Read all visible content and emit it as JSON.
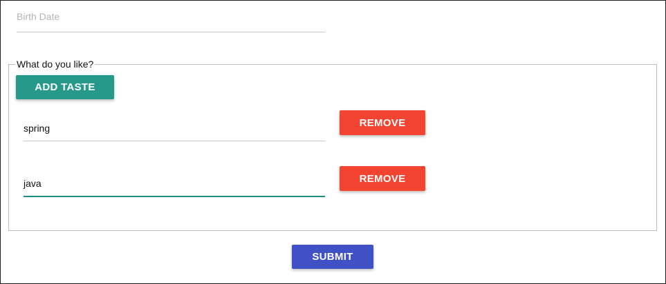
{
  "form": {
    "birth_date_label": "Birth Date",
    "fieldset_legend": "What do you like?",
    "add_taste_label": "ADD TASTE",
    "submit_label": "SUBMIT",
    "tastes": [
      {
        "value": "spring",
        "remove_label": "REMOVE"
      },
      {
        "value": "java",
        "remove_label": "REMOVE"
      }
    ]
  },
  "colors": {
    "add_button": "#26998a",
    "remove_button": "#f24430",
    "submit_button": "#3f51c4",
    "focus_underline": "#1b8f80"
  }
}
